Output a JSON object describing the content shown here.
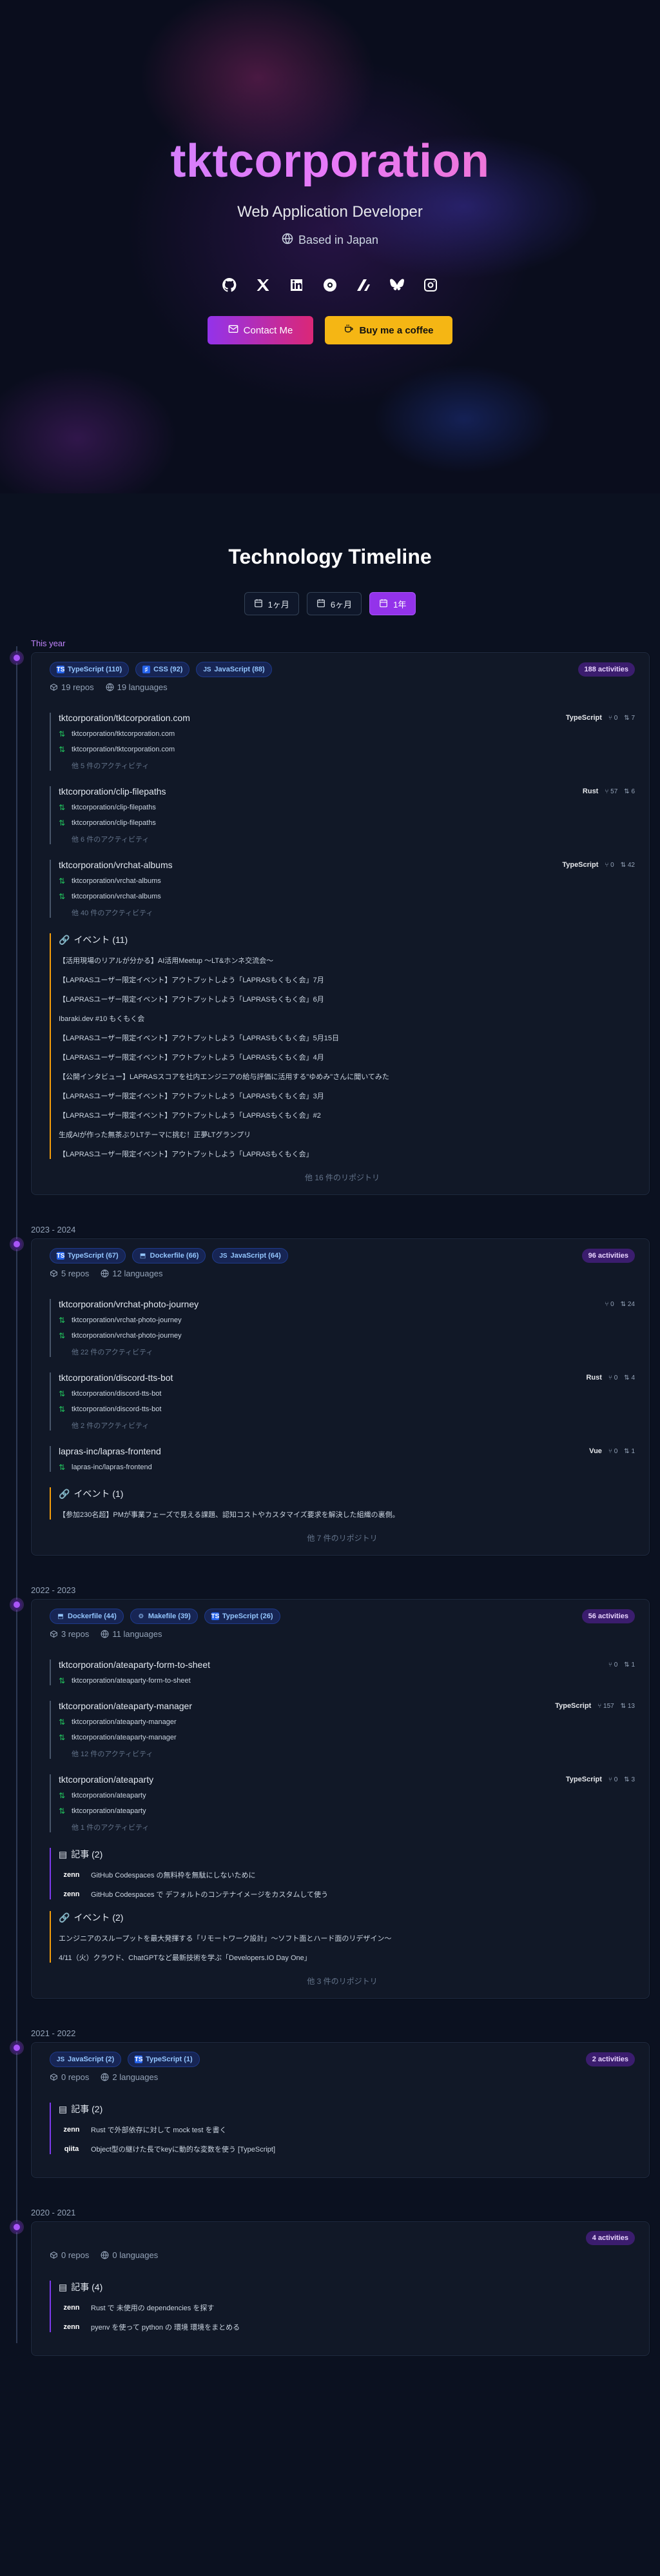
{
  "hero": {
    "name": "tktcorporation",
    "role": "Web Application Developer",
    "location": "Based in Japan",
    "contact_label": "Contact Me",
    "coffee_label": "Buy me a coffee"
  },
  "timeline_title": "Technology Timeline",
  "range_buttons": [
    {
      "label": "1ヶ月",
      "active": false
    },
    {
      "label": "6ヶ月",
      "active": false
    },
    {
      "label": "1年",
      "active": true
    }
  ],
  "periods": [
    {
      "label": "This year",
      "chips": [
        {
          "icon": "TS",
          "label": "TypeScript (110)"
        },
        {
          "icon": "css",
          "label": "CSS (92)"
        },
        {
          "icon": "JS",
          "label": "JavaScript (88)"
        }
      ],
      "activities": "188 activities",
      "repos_count": "19 repos",
      "languages_count": "19 languages",
      "repos": [
        {
          "name": "tktcorporation/tktcorporation.com",
          "lang": "TypeScript",
          "stars": "0",
          "prs": "7",
          "commits": [
            "tktcorporation/tktcorporation.com",
            "tktcorporation/tktcorporation.com"
          ],
          "more": "他 5 件のアクティビティ"
        },
        {
          "name": "tktcorporation/clip-filepaths",
          "lang": "Rust",
          "stars": "57",
          "prs": "6",
          "commits": [
            "tktcorporation/clip-filepaths",
            "tktcorporation/clip-filepaths"
          ],
          "more": "他 6 件のアクティビティ"
        },
        {
          "name": "tktcorporation/vrchat-albums",
          "lang": "TypeScript",
          "stars": "0",
          "prs": "42",
          "commits": [
            "tktcorporation/vrchat-albums",
            "tktcorporation/vrchat-albums"
          ],
          "more": "他 40 件のアクティビティ"
        }
      ],
      "events": {
        "title": "イベント (11)",
        "items": [
          "【活用現場のリアルが分かる】AI活用Meetup 〜LT&ホンネ交流会〜",
          "【LAPRASユーザー限定イベント】アウトプットしよう「LAPRASもくもく会」7月",
          "【LAPRASユーザー限定イベント】アウトプットしよう「LAPRASもくもく会」6月",
          "Ibaraki.dev #10 もくもく会",
          "【LAPRASユーザー限定イベント】アウトプットしよう「LAPRASもくもく会」5月15日",
          "【LAPRASユーザー限定イベント】アウトプットしよう「LAPRASもくもく会」4月",
          "【公開インタビュー】LAPRASスコアを社内エンジニアの給与評価に活用する\"ゆめみ\"さんに聞いてみた",
          "【LAPRASユーザー限定イベント】アウトプットしよう「LAPRASもくもく会」3月",
          "【LAPRASユーザー限定イベント】アウトプットしよう「LAPRASもくもく会」#2",
          "生成AIが作った無茶ぶりLTテーマに挑む！正夢LTグランプリ",
          "【LAPRASユーザー限定イベント】アウトプットしよう「LAPRASもくもく会」"
        ]
      },
      "more_repos": "他 16 件のリポジトリ"
    },
    {
      "label": "2023 - 2024",
      "chips": [
        {
          "icon": "TS",
          "label": "TypeScript (67)"
        },
        {
          "icon": "docker",
          "label": "Dockerfile (66)"
        },
        {
          "icon": "JS",
          "label": "JavaScript (64)"
        }
      ],
      "activities": "96 activities",
      "repos_count": "5 repos",
      "languages_count": "12 languages",
      "repos": [
        {
          "name": "tktcorporation/vrchat-photo-journey",
          "lang": "",
          "stars": "0",
          "prs": "24",
          "commits": [
            "tktcorporation/vrchat-photo-journey",
            "tktcorporation/vrchat-photo-journey"
          ],
          "more": "他 22 件のアクティビティ"
        },
        {
          "name": "tktcorporation/discord-tts-bot",
          "lang": "Rust",
          "stars": "0",
          "prs": "4",
          "commits": [
            "tktcorporation/discord-tts-bot",
            "tktcorporation/discord-tts-bot"
          ],
          "more": "他 2 件のアクティビティ"
        },
        {
          "name": "lapras-inc/lapras-frontend",
          "lang": "Vue",
          "stars": "0",
          "prs": "1",
          "commits": [
            "lapras-inc/lapras-frontend"
          ],
          "more": ""
        }
      ],
      "events": {
        "title": "イベント (1)",
        "items": [
          "【参加230名超】PMが事業フェーズで見える課題、認知コストやカスタマイズ要求を解決した組織の裏側。"
        ]
      },
      "more_repos": "他 7 件のリポジトリ"
    },
    {
      "label": "2022 - 2023",
      "chips": [
        {
          "icon": "docker",
          "label": "Dockerfile (44)"
        },
        {
          "icon": "make",
          "label": "Makefile (39)"
        },
        {
          "icon": "TS",
          "label": "TypeScript (26)"
        }
      ],
      "activities": "56 activities",
      "repos_count": "3 repos",
      "languages_count": "11 languages",
      "repos": [
        {
          "name": "tktcorporation/ateaparty-form-to-sheet",
          "lang": "",
          "stars": "0",
          "prs": "1",
          "commits": [
            "tktcorporation/ateaparty-form-to-sheet"
          ],
          "more": ""
        },
        {
          "name": "tktcorporation/ateaparty-manager",
          "lang": "TypeScript",
          "stars": "157",
          "prs": "13",
          "commits": [
            "tktcorporation/ateaparty-manager",
            "tktcorporation/ateaparty-manager"
          ],
          "more": "他 12 件のアクティビティ"
        },
        {
          "name": "tktcorporation/ateaparty",
          "lang": "TypeScript",
          "stars": "0",
          "prs": "3",
          "commits": [
            "tktcorporation/ateaparty",
            "tktcorporation/ateaparty"
          ],
          "more": "他 1 件のアクティビティ"
        }
      ],
      "articles": {
        "title": "記事 (2)",
        "items": [
          {
            "source": "zenn",
            "title": "GitHub Codespaces の無料枠を無駄にしないために"
          },
          {
            "source": "zenn",
            "title": "GitHub Codespaces で デフォルトのコンテナイメージをカスタムして使う"
          }
        ]
      },
      "events": {
        "title": "イベント (2)",
        "items": [
          "エンジニアのスループットを最大発揮する「リモートワーク設計」～ソフト面とハード面のリデザイン～",
          "4/11（火）クラウド、ChatGPTなど最新技術を学ぶ「Developers.IO Day One」"
        ]
      },
      "more_repos": "他 3 件のリポジトリ"
    },
    {
      "label": "2021 - 2022",
      "chips": [
        {
          "icon": "JS",
          "label": "JavaScript (2)"
        },
        {
          "icon": "TS",
          "label": "TypeScript (1)"
        }
      ],
      "activities": "2 activities",
      "repos_count": "0 repos",
      "languages_count": "2 languages",
      "repos": [],
      "articles": {
        "title": "記事 (2)",
        "items": [
          {
            "source": "zenn",
            "title": "Rust で外部依存に対して mock test を書く"
          },
          {
            "source": "qiita",
            "title": "Object型の継けた長でkeyに動的な変数を使う [TypeScript]"
          }
        ]
      },
      "more_repos": ""
    },
    {
      "label": "2020 - 2021",
      "chips": [],
      "activities": "4 activities",
      "repos_count": "0 repos",
      "languages_count": "0 languages",
      "repos": [],
      "articles": {
        "title": "記事 (4)",
        "items": [
          {
            "source": "zenn",
            "title": "Rust で 未使用の dependencies を探す"
          },
          {
            "source": "zenn",
            "title": "pyenv を使って python の 環境 環境をまとめる"
          }
        ]
      },
      "more_repos": ""
    }
  ]
}
